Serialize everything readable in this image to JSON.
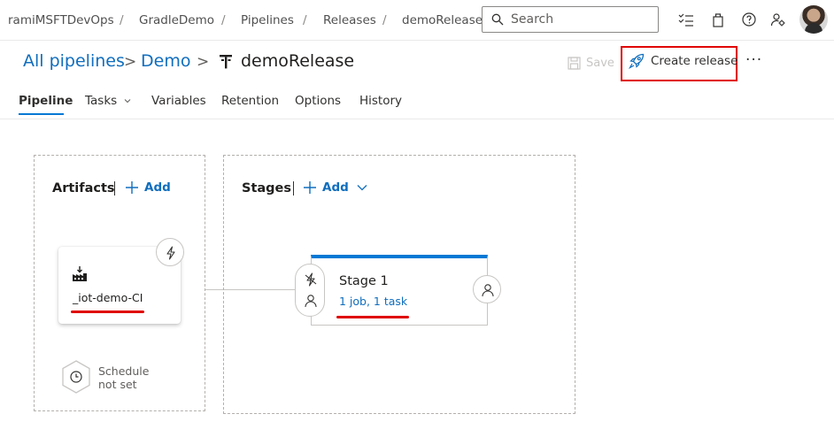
{
  "breadcrumb": {
    "items": [
      "ramiMSFTDevOps",
      "GradleDemo",
      "Pipelines",
      "Releases",
      "demoRelease"
    ],
    "separator": "/"
  },
  "search": {
    "placeholder": "Search"
  },
  "top_icons": [
    "task-list-icon",
    "shopping-bag-icon",
    "help-icon",
    "user-settings-icon"
  ],
  "header": {
    "links": [
      "All pipelines",
      "Demo"
    ],
    "chevron": ">",
    "title": "demoRelease",
    "save_label": "Save",
    "create_release_label": "Create release",
    "more_label": "···"
  },
  "tabs": [
    {
      "label": "Pipeline",
      "active": true
    },
    {
      "label": "Tasks",
      "has_dropdown": true
    },
    {
      "label": "Variables"
    },
    {
      "label": "Retention"
    },
    {
      "label": "Options"
    },
    {
      "label": "History"
    }
  ],
  "artifacts": {
    "title": "Artifacts",
    "add_label": "Add",
    "artifact_name": "_iot-demo-CI",
    "schedule_text_line1": "Schedule",
    "schedule_text_line2": "not set"
  },
  "stages": {
    "title": "Stages",
    "add_label": "Add",
    "stage": {
      "name": "Stage 1",
      "summary": "1 job, 1 task"
    }
  },
  "colors": {
    "accent": "#0078d4",
    "link": "#106ebe",
    "highlight": "#e00000"
  }
}
